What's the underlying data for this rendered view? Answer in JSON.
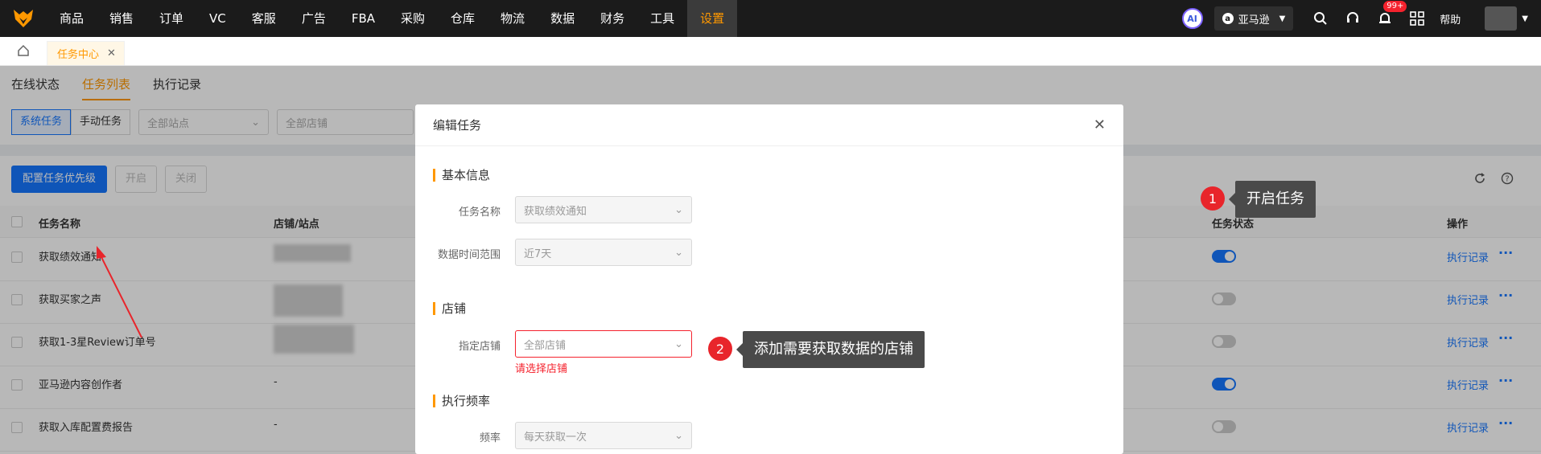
{
  "nav": {
    "items": [
      "商品",
      "销售",
      "订单",
      "VC",
      "客服",
      "广告",
      "FBA",
      "采购",
      "仓库",
      "物流",
      "数据",
      "财务",
      "工具",
      "设置"
    ],
    "active_index": 13,
    "ai_label": "AI",
    "marketplace": "亚马逊",
    "notif_badge": "99+",
    "help": "帮助"
  },
  "tabs": {
    "page_tab": "任务中心"
  },
  "subtabs": [
    "在线状态",
    "任务列表",
    "执行记录"
  ],
  "filters": {
    "seg": [
      "系统任务",
      "手动任务"
    ],
    "site_placeholder": "全部站点",
    "shop_placeholder": "全部店铺"
  },
  "actions": {
    "config_priority": "配置任务优先级",
    "enable": "开启",
    "disable": "关闭"
  },
  "table": {
    "headers": {
      "name": "任务名称",
      "shop": "店铺/站点",
      "status": "任务状态",
      "ops": "操作"
    },
    "rows": [
      {
        "name": "获取绩效通知",
        "shop": "",
        "status": "on",
        "exec": "执行记录",
        "more": "···"
      },
      {
        "name": "获取买家之声",
        "shop": "",
        "status": "off",
        "exec": "执行记录",
        "more": "···"
      },
      {
        "name": "获取1-3星Review订单号",
        "shop": "",
        "status": "off",
        "exec": "执行记录",
        "more": "···"
      },
      {
        "name": "亚马逊内容创作者",
        "shop": "-",
        "status": "on",
        "exec": "执行记录",
        "more": "···"
      },
      {
        "name": "获取入库配置费报告",
        "shop": "-",
        "status": "off",
        "exec": "执行记录",
        "more": "···"
      }
    ]
  },
  "modal": {
    "title": "编辑任务",
    "sections": {
      "basic": "基本信息",
      "shop": "店铺",
      "freq": "执行频率"
    },
    "fields": {
      "task_name_label": "任务名称",
      "task_name_value": "获取绩效通知",
      "range_label": "数据时间范围",
      "range_value": "近7天",
      "shop_label": "指定店铺",
      "shop_placeholder": "全部店铺",
      "shop_error": "请选择店铺",
      "freq_label": "频率",
      "freq_value": "每天获取一次"
    }
  },
  "callouts": {
    "c1_num": "1",
    "c1_text": "开启任务",
    "c2_num": "2",
    "c2_text": "添加需要获取数据的店铺"
  },
  "colors": {
    "accent": "#ff9800",
    "primary": "#1677ff",
    "error": "#f5222d",
    "callout_num": "#e8252b"
  }
}
